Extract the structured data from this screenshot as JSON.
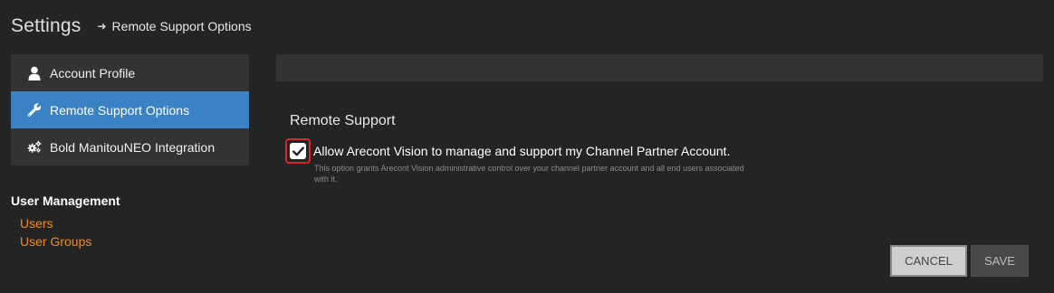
{
  "header": {
    "title": "Settings",
    "breadcrumb_icon": "arrow-right-icon",
    "breadcrumb": "Remote Support Options"
  },
  "sidebar": {
    "items": [
      {
        "label": "Account Profile",
        "icon": "user-icon",
        "active": false
      },
      {
        "label": "Remote Support Options",
        "icon": "wrench-icon",
        "active": true
      },
      {
        "label": "Bold ManitouNEO Integration",
        "icon": "gears-icon",
        "active": false
      }
    ]
  },
  "user_management": {
    "title": "User Management",
    "links": [
      "Users",
      "User Groups"
    ]
  },
  "main": {
    "heading": "Remote Support",
    "checkbox": {
      "checked": true,
      "label": "Allow Arecont Vision to manage and support my Channel Partner Account.",
      "help": "This option grants Arecont Vision administrative control over your channel partner account and all end users associated with it."
    }
  },
  "buttons": {
    "cancel": "CANCEL",
    "save": "SAVE"
  },
  "colors": {
    "background": "#242424",
    "panel": "#333333",
    "active": "#3a82c4",
    "link": "#ef8a24",
    "highlight": "#d9262a"
  }
}
